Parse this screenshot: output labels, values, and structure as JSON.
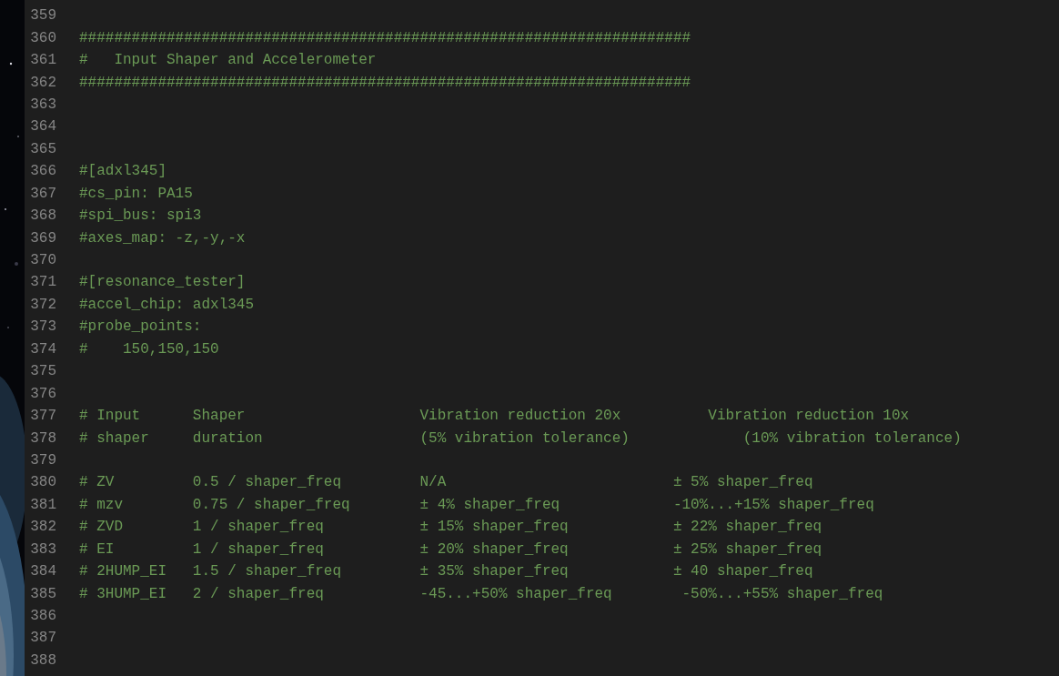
{
  "editor": {
    "lines": [
      {
        "number": "359"
      },
      {
        "number": "360",
        "text": "######################################################################"
      },
      {
        "number": "361",
        "text": "#   Input Shaper and Accelerometer"
      },
      {
        "number": "362",
        "text": "######################################################################"
      },
      {
        "number": "363"
      },
      {
        "number": "364"
      },
      {
        "number": "365"
      },
      {
        "number": "366",
        "text": "#[adxl345]"
      },
      {
        "number": "367",
        "text": "#cs_pin: PA15"
      },
      {
        "number": "368",
        "text": "#spi_bus: spi3"
      },
      {
        "number": "369",
        "text": "#axes_map: -z,-y,-x"
      },
      {
        "number": "370"
      },
      {
        "number": "371",
        "text": "#[resonance_tester]"
      },
      {
        "number": "372",
        "text": "#accel_chip: adxl345"
      },
      {
        "number": "373",
        "text": "#probe_points:"
      },
      {
        "number": "374",
        "text": "#    150,150,150"
      },
      {
        "number": "375"
      },
      {
        "number": "376"
      },
      {
        "number": "377",
        "text": "# Input      Shaper                    Vibration reduction 20x          Vibration reduction 10x"
      },
      {
        "number": "378",
        "text": "# shaper     duration                  (5% vibration tolerance)             (10% vibration tolerance)"
      },
      {
        "number": "379"
      },
      {
        "number": "380",
        "text": "# ZV         0.5 / shaper_freq         N/A                          ± 5% shaper_freq"
      },
      {
        "number": "381",
        "text": "# mzv        0.75 / shaper_freq        ± 4% shaper_freq             -10%...+15% shaper_freq"
      },
      {
        "number": "382",
        "text": "# ZVD        1 / shaper_freq           ± 15% shaper_freq            ± 22% shaper_freq"
      },
      {
        "number": "383",
        "text": "# EI         1 / shaper_freq           ± 20% shaper_freq            ± 25% shaper_freq"
      },
      {
        "number": "384",
        "text": "# 2HUMP_EI   1.5 / shaper_freq         ± 35% shaper_freq            ± 40 shaper_freq"
      },
      {
        "number": "385",
        "text": "# 3HUMP_EI   2 / shaper_freq           -45...+50% shaper_freq        -50%...+55% shaper_freq"
      },
      {
        "number": "386"
      },
      {
        "number": "387"
      },
      {
        "number": "388"
      }
    ]
  }
}
